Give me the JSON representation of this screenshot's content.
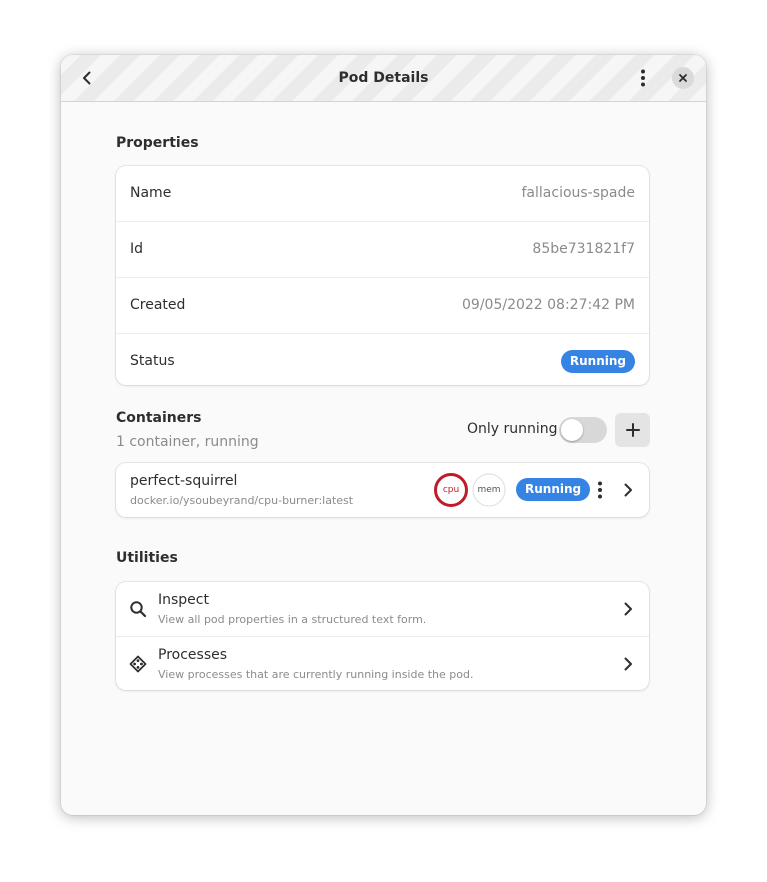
{
  "window": {
    "title": "Pod Details"
  },
  "properties": {
    "heading": "Properties",
    "rows": [
      {
        "label": "Name",
        "value": "fallacious-spade"
      },
      {
        "label": "Id",
        "value": "85be731821f7"
      },
      {
        "label": "Created",
        "value": "09/05/2022 08:27:42 PM"
      },
      {
        "label": "Status",
        "value": "Running"
      }
    ]
  },
  "containers": {
    "heading": "Containers",
    "subtitle": "1 container, running",
    "filter_label": "Only running",
    "filter_enabled": false,
    "items": [
      {
        "name": "perfect-squirrel",
        "image": "docker.io/ysoubeyrand/cpu-burner:latest",
        "cpu_label": "cpu",
        "mem_label": "mem",
        "status": "Running"
      }
    ]
  },
  "utilities": {
    "heading": "Utilities",
    "items": [
      {
        "title": "Inspect",
        "description": "View all pod properties in a structured text form.",
        "icon": "search-icon"
      },
      {
        "title": "Processes",
        "description": "View processes that are currently running inside the pod.",
        "icon": "processes-icon"
      }
    ]
  },
  "colors": {
    "accent": "#3584e4",
    "cpu_gauge": "#c01c28",
    "window_bg": "#fafafa"
  }
}
